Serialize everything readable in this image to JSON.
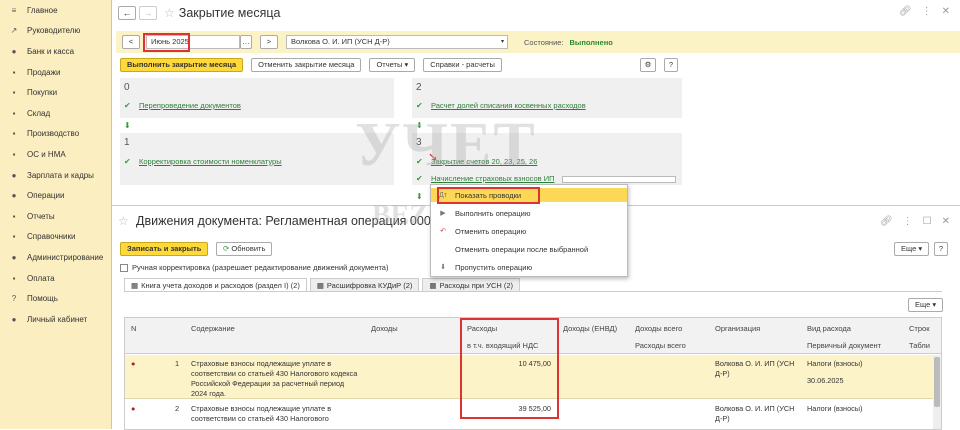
{
  "sidebar": {
    "items": [
      {
        "icon": "menu-icon",
        "glyph": "≡",
        "label": "Главное"
      },
      {
        "icon": "trend-icon",
        "glyph": "↗",
        "label": "Руководителю"
      },
      {
        "icon": "bank-icon",
        "glyph": "●",
        "label": "Банк и касса"
      },
      {
        "icon": "cart-icon",
        "glyph": "▪",
        "label": "Продажи"
      },
      {
        "icon": "basket-icon",
        "glyph": "▪",
        "label": "Покупки"
      },
      {
        "icon": "warehouse-icon",
        "glyph": "▪",
        "label": "Склад"
      },
      {
        "icon": "factory-icon",
        "glyph": "▪",
        "label": "Производство"
      },
      {
        "icon": "assets-icon",
        "glyph": "▪",
        "label": "ОС и НМА"
      },
      {
        "icon": "salary-icon",
        "glyph": "●",
        "label": "Зарплата и кадры"
      },
      {
        "icon": "operations-icon",
        "glyph": "●",
        "label": "Операции"
      },
      {
        "icon": "reports-icon",
        "glyph": "▪",
        "label": "Отчеты"
      },
      {
        "icon": "reference-icon",
        "glyph": "▪",
        "label": "Справочники"
      },
      {
        "icon": "admin-icon",
        "glyph": "●",
        "label": "Администрирование"
      },
      {
        "icon": "payment-icon",
        "glyph": "▪",
        "label": "Оплата"
      },
      {
        "icon": "help-icon",
        "glyph": "?",
        "label": "Помощь"
      },
      {
        "icon": "account-icon",
        "glyph": "●",
        "label": "Личный кабинет"
      }
    ]
  },
  "top": {
    "title": "Закрытие месяца",
    "period": "Июнь 2025",
    "organization": "Волкова О. И. ИП (УСН Д-Р)",
    "state_label": "Состояние:",
    "state_value": "Выполнено",
    "btn_run": "Выполнить закрытие месяца",
    "btn_cancel": "Отменить закрытие месяца",
    "btn_reports": "Отчеты",
    "btn_refs": "Справки - расчеты",
    "btn_help": "?",
    "sections": [
      {
        "num": "0",
        "link": "Перепроведение документов"
      },
      {
        "num": "1",
        "link": "Корректировка стоимости номенклатуры"
      },
      {
        "num": "2",
        "link": "Расчет долей списания косвенных расходов"
      },
      {
        "num": "3",
        "link": "Закрытие счетов 20, 23, 25, 26",
        "link2": "Начисление страховых взносов ИП"
      }
    ]
  },
  "context_menu": {
    "items": [
      {
        "icon": "postings-icon",
        "label": "Показать проводки"
      },
      {
        "icon": "run-icon",
        "label": "Выполнить операцию"
      },
      {
        "icon": "undo-icon",
        "label": "Отменить операцию"
      },
      {
        "icon": "undo-after-icon",
        "label": "Отменить операции после выбранной"
      },
      {
        "icon": "skip-icon",
        "label": "Пропустить операцию"
      }
    ]
  },
  "bottom": {
    "title": "Движения документа: Регламентная операция 0000-00008",
    "btn_save": "Записать и закрыть",
    "btn_refresh": "Обновить",
    "btn_more": "Еще",
    "btn_help": "?",
    "manual_label": "Ручная корректировка (разрешает редактирование движений документа)",
    "tabs": [
      "Книга учета доходов и расходов (раздел I) (2)",
      "Расшифровка КУДиР (2)",
      "Расходы при УСН (2)"
    ],
    "grid_more": "Еще",
    "headers": [
      "N",
      "Содержание",
      "Доходы",
      "Расходы",
      "Доходы (ЕНВД)",
      "Доходы всего",
      "Организация",
      "Вид расхода",
      "Строк"
    ],
    "subheaders": {
      "expenses": "в т.ч. входящий НДС",
      "income_total": "Расходы всего",
      "expense_kind": "Первичный документ",
      "tab": "Табли"
    },
    "rows": [
      {
        "n": "1",
        "content": "Страховые взносы подлежащие уплате в соответствии со статьей 430 Налогового кодекса Российской Федерации за расчетный период 2024 года.",
        "expenses": "10 475,00",
        "org": "Волкова О. И. ИП (УСН Д-Р)",
        "kind": "Налоги (взносы)",
        "date": "30.06.2025"
      },
      {
        "n": "2",
        "content": "Страховые взносы подлежащие уплате в соответствии со статьей 430 Налогового",
        "expenses": "39 525,00",
        "org": "Волкова О. И. ИП (УСН Д-Р)",
        "kind": "Налоги (взносы)",
        "date": ""
      }
    ]
  },
  "watermark": {
    "line1": "УЧЕТ",
    "line2": "BEZ ЗАБОТ"
  }
}
